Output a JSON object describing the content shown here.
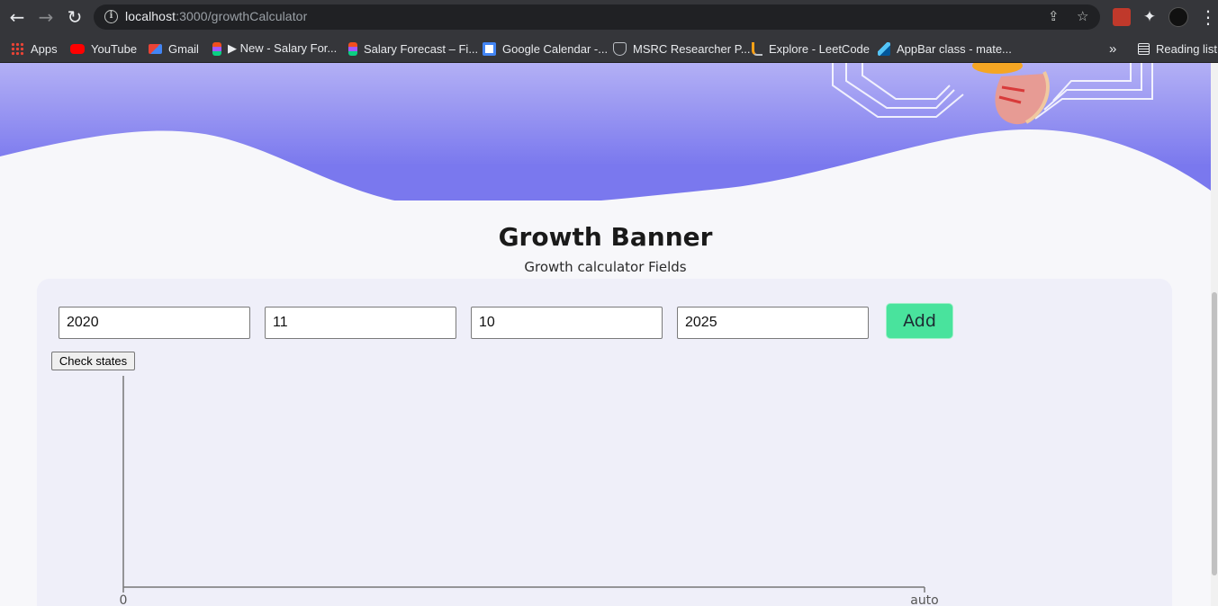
{
  "browser": {
    "url_host": "localhost",
    "url_path": ":3000/growthCalculator",
    "bookmarks": [
      {
        "label": "Apps",
        "icon": "apps-grid-icon"
      },
      {
        "label": "YouTube",
        "icon": "youtube-icon"
      },
      {
        "label": "Gmail",
        "icon": "gmail-icon"
      },
      {
        "label": "▶ New - Salary For...",
        "icon": "figma-icon"
      },
      {
        "label": "Salary Forecast – Fi...",
        "icon": "figma-icon"
      },
      {
        "label": "Google Calendar -...",
        "icon": "google-calendar-icon"
      },
      {
        "label": "MSRC Researcher P...",
        "icon": "shield-icon"
      },
      {
        "label": "Explore - LeetCode",
        "icon": "leetcode-icon"
      },
      {
        "label": "AppBar class - mate...",
        "icon": "flutter-icon"
      }
    ],
    "overflow_label": "»",
    "reading_list_label": "Reading list"
  },
  "page": {
    "title": "Growth Banner",
    "subtitle": "Growth calculator Fields",
    "fields": [
      {
        "value": "2020"
      },
      {
        "value": "11"
      },
      {
        "value": "10"
      },
      {
        "value": "2025"
      }
    ],
    "add_label": "Add",
    "check_states_label": "Check states"
  },
  "chart_data": {
    "type": "line",
    "x": [],
    "series": [],
    "x_tick_labels": [
      "0",
      "auto"
    ],
    "title": "",
    "xlabel": "",
    "ylabel": ""
  },
  "colors": {
    "banner_top": "#b3b0f5",
    "banner_bottom": "#7a78ee",
    "add_button": "#49e39d",
    "card_bg": "#efeff9"
  }
}
